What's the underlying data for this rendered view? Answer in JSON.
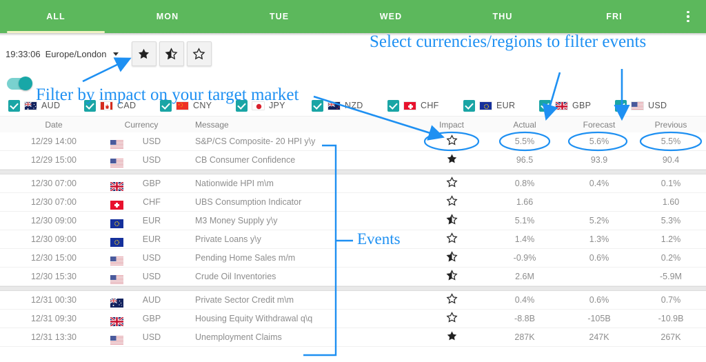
{
  "tabs": [
    {
      "label": "ALL",
      "active": true
    },
    {
      "label": "MON",
      "active": false
    },
    {
      "label": "TUE",
      "active": false
    },
    {
      "label": "WED",
      "active": false
    },
    {
      "label": "THU",
      "active": false
    },
    {
      "label": "FRI",
      "active": false
    }
  ],
  "overflow_menu": "more-options",
  "toolbar": {
    "time": "19:33:06",
    "timezone": "Europe/London",
    "impact_buttons": [
      {
        "name": "star-full",
        "state": "full"
      },
      {
        "name": "star-half",
        "state": "half"
      },
      {
        "name": "star-empty",
        "state": "empty"
      }
    ]
  },
  "impact_toggle": {
    "enabled": true
  },
  "currencies": [
    {
      "code": "AUD",
      "checked": true,
      "flag": "au"
    },
    {
      "code": "CAD",
      "checked": true,
      "flag": "ca"
    },
    {
      "code": "CNY",
      "checked": true,
      "flag": "cn"
    },
    {
      "code": "JPY",
      "checked": true,
      "flag": "jp"
    },
    {
      "code": "NZD",
      "checked": true,
      "flag": "nz"
    },
    {
      "code": "CHF",
      "checked": true,
      "flag": "ch"
    },
    {
      "code": "EUR",
      "checked": true,
      "flag": "eu"
    },
    {
      "code": "GBP",
      "checked": true,
      "flag": "gb"
    },
    {
      "code": "USD",
      "checked": true,
      "flag": "us"
    }
  ],
  "table": {
    "headers": {
      "date": "Date",
      "currency": "Currency",
      "message": "Message",
      "impact": "Impact",
      "actual": "Actual",
      "forecast": "Forecast",
      "previous": "Previous"
    },
    "groups": [
      {
        "rows": [
          {
            "date": "12/29 14:00",
            "flag": "us",
            "currency": "USD",
            "message": "S&P/CS Composite- 20 HPI y\\y",
            "impact": "empty",
            "actual": "5.5%",
            "forecast": "5.6%",
            "previous": "5.5%"
          },
          {
            "date": "12/29 15:00",
            "flag": "us",
            "currency": "USD",
            "message": "CB Consumer Confidence",
            "impact": "full",
            "actual": "96.5",
            "forecast": "93.9",
            "previous": "90.4"
          }
        ]
      },
      {
        "rows": [
          {
            "date": "12/30 07:00",
            "flag": "gb",
            "currency": "GBP",
            "message": "Nationwide HPI m\\m",
            "impact": "empty",
            "actual": "0.8%",
            "forecast": "0.4%",
            "previous": "0.1%"
          },
          {
            "date": "12/30 07:00",
            "flag": "ch",
            "currency": "CHF",
            "message": "UBS Consumption Indicator",
            "impact": "empty",
            "actual": "1.66",
            "forecast": "",
            "previous": "1.60"
          },
          {
            "date": "12/30 09:00",
            "flag": "eu",
            "currency": "EUR",
            "message": "M3 Money Supply y\\y",
            "impact": "half",
            "actual": "5.1%",
            "forecast": "5.2%",
            "previous": "5.3%"
          },
          {
            "date": "12/30 09:00",
            "flag": "eu",
            "currency": "EUR",
            "message": "Private Loans y\\y",
            "impact": "empty",
            "actual": "1.4%",
            "forecast": "1.3%",
            "previous": "1.2%"
          },
          {
            "date": "12/30 15:00",
            "flag": "us",
            "currency": "USD",
            "message": "Pending Home Sales m/m",
            "impact": "half",
            "actual": "-0.9%",
            "forecast": "0.6%",
            "previous": "0.2%"
          },
          {
            "date": "12/30 15:30",
            "flag": "us",
            "currency": "USD",
            "message": "Crude Oil Inventories",
            "impact": "half",
            "actual": "2.6M",
            "forecast": "",
            "previous": "-5.9M"
          }
        ]
      },
      {
        "rows": [
          {
            "date": "12/31 00:30",
            "flag": "au",
            "currency": "AUD",
            "message": "Private Sector Credit m\\m",
            "impact": "empty",
            "actual": "0.4%",
            "forecast": "0.6%",
            "previous": "0.7%"
          },
          {
            "date": "12/31 09:30",
            "flag": "gb",
            "currency": "GBP",
            "message": "Housing Equity Withdrawal q\\q",
            "impact": "empty",
            "actual": "-8.8B",
            "forecast": "-105B",
            "previous": "-10.9B"
          },
          {
            "date": "12/31 13:30",
            "flag": "us",
            "currency": "USD",
            "message": "Unemployment Claims",
            "impact": "full",
            "actual": "287K",
            "forecast": "247K",
            "previous": "267K"
          }
        ]
      }
    ]
  },
  "annotations": {
    "select_currencies": "Select currencies/regions to filter events",
    "filter_impact": "Filter by impact on your target market",
    "events": "Events",
    "color": "#1e90f2"
  }
}
